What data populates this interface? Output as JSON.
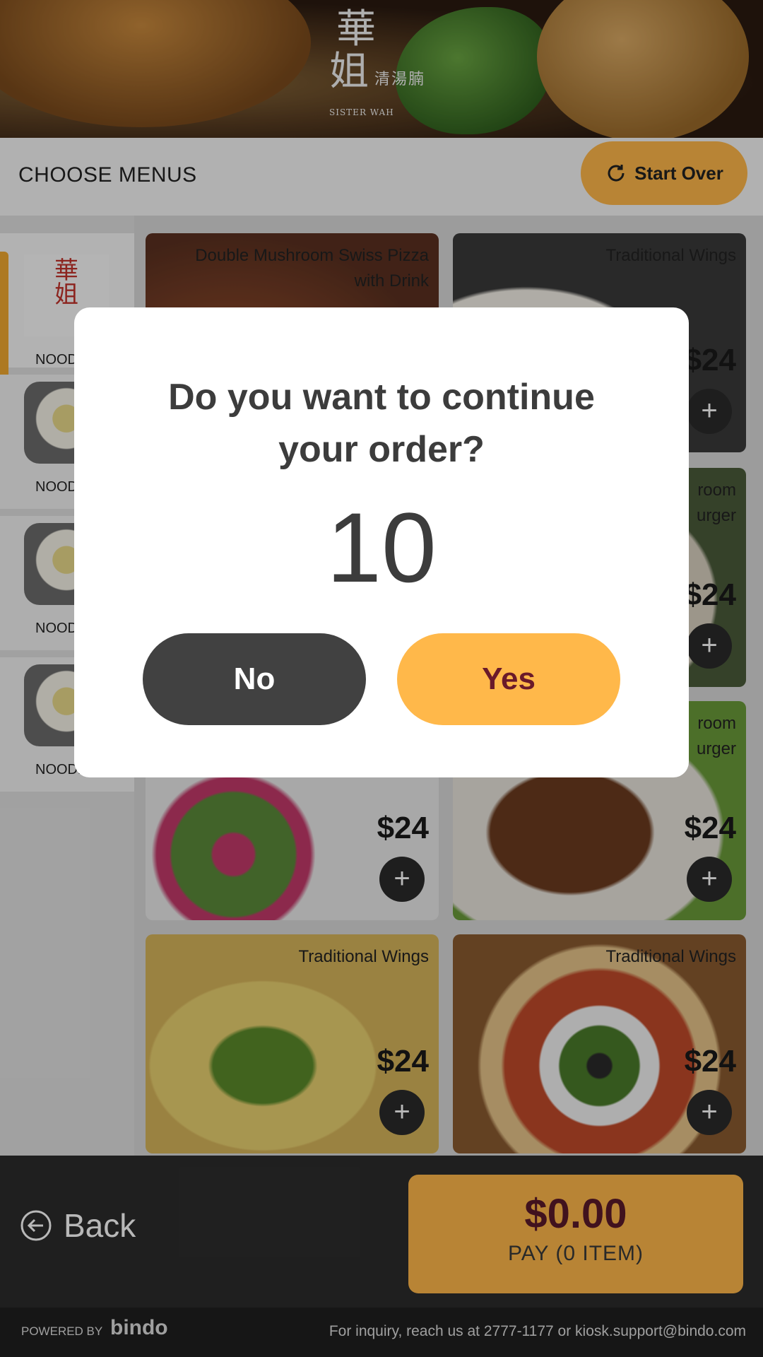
{
  "hero": {
    "logo_char_1": "華",
    "logo_char_2": "姐",
    "logo_small": "清湯腩",
    "logo_en": "SISTER WAH"
  },
  "header": {
    "title": "CHOOSE MENUS",
    "start_over_label": "Start Over",
    "start_over_icon": "refresh-icon"
  },
  "sidebar": {
    "items": [
      {
        "label": "NOODLES",
        "logo_char_1": "華",
        "logo_char_2": "姐",
        "active": true
      },
      {
        "label": "NOODLES",
        "active": false
      },
      {
        "label": "NOODLES",
        "active": false
      },
      {
        "label": "NOODLES",
        "active": false
      }
    ]
  },
  "products": [
    {
      "name_line1": "Double Mushroom Swiss Pizza",
      "name_line2": "with Drink",
      "price": ""
    },
    {
      "name_line1": "Traditional Wings",
      "name_line2": "",
      "price": "$24"
    },
    {
      "name_line1": "room",
      "name_line2": "urger",
      "price": "$24"
    },
    {
      "name_line1": "",
      "name_line2": "",
      "price": "$24"
    },
    {
      "name_line1": "room",
      "name_line2": "urger",
      "price": "$24"
    },
    {
      "name_line1": "Traditional Wings",
      "name_line2": "",
      "price": "$24"
    },
    {
      "name_line1": "Traditional Wings",
      "name_line2": "",
      "price": "$24"
    }
  ],
  "add_symbol": "+",
  "bottom": {
    "back_label": "Back",
    "pay_amount": "$0.00",
    "pay_label": "PAY (0 ITEM)"
  },
  "footer": {
    "powered_by": "POWERED BY",
    "brand": "bindo",
    "contact": "For inquiry, reach us at 2777-1177 or  kiosk.support@bindo.com"
  },
  "modal": {
    "question_line1": "Do you want to continue",
    "question_line2": "your order?",
    "countdown": "10",
    "no_label": "No",
    "yes_label": "Yes"
  },
  "colors": {
    "accent": "#ffb84a",
    "dark_button": "#414141",
    "yes_text": "#6a1a2a"
  }
}
